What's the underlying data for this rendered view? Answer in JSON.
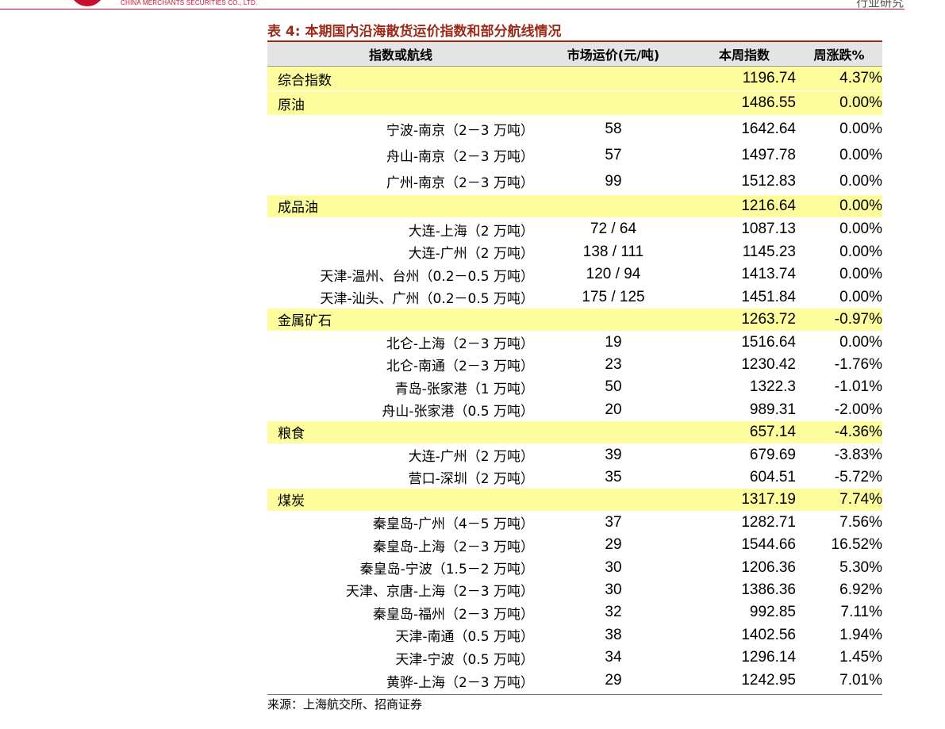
{
  "header": {
    "brand_text": "CHINA MERCHANTS SECURITIES CO., LTD.",
    "corner_text": "行业研究"
  },
  "table": {
    "caption": "表 4:  本期国内沿海散货运价指数和部分航线情况",
    "columns": [
      "指数或航线",
      "市场运价(元/吨)",
      "本周指数",
      "周涨跌%"
    ],
    "rows": [
      {
        "name": "综合指数",
        "price": "",
        "index": "1196.74",
        "change": "4.37%",
        "category": true
      },
      {
        "name": "原油",
        "price": "",
        "index": "1486.55",
        "change": "0.00%",
        "category": true
      },
      {
        "name": "宁波-南京（2－3 万吨）",
        "price": "58",
        "index": "1642.64",
        "change": "0.00%",
        "category": false
      },
      {
        "name": "舟山-南京（2－3 万吨）",
        "price": "57",
        "index": "1497.78",
        "change": "0.00%",
        "category": false
      },
      {
        "name": "广州-南京（2－3 万吨）",
        "price": "99",
        "index": "1512.83",
        "change": "0.00%",
        "category": false
      },
      {
        "name": "成品油",
        "price": "",
        "index": "1216.64",
        "change": "0.00%",
        "category": true
      },
      {
        "name": "大连-上海（2 万吨）",
        "price": "72 / 64",
        "index": "1087.13",
        "change": "0.00%",
        "category": false
      },
      {
        "name": "大连-广州（2 万吨）",
        "price": "138 / 111",
        "index": "1145.23",
        "change": "0.00%",
        "category": false
      },
      {
        "name": "天津-温州、台州（0.2－0.5 万吨）",
        "price": "120 / 94",
        "index": "1413.74",
        "change": "0.00%",
        "category": false
      },
      {
        "name": "天津-汕头、广州（0.2－0.5 万吨）",
        "price": "175 / 125",
        "index": "1451.84",
        "change": "0.00%",
        "category": false
      },
      {
        "name": "金属矿石",
        "price": "",
        "index": "1263.72",
        "change": "-0.97%",
        "category": true
      },
      {
        "name": "北仑-上海（2－3 万吨）",
        "price": "19",
        "index": "1516.64",
        "change": "0.00%",
        "category": false
      },
      {
        "name": "北仑-南通（2－3 万吨）",
        "price": "23",
        "index": "1230.42",
        "change": "-1.76%",
        "category": false
      },
      {
        "name": "青岛-张家港（1 万吨）",
        "price": "50",
        "index": "1322.3",
        "change": "-1.01%",
        "category": false
      },
      {
        "name": "舟山-张家港（0.5 万吨）",
        "price": "20",
        "index": "989.31",
        "change": "-2.00%",
        "category": false
      },
      {
        "name": "粮食",
        "price": "",
        "index": "657.14",
        "change": "-4.36%",
        "category": true
      },
      {
        "name": "大连-广州（2 万吨）",
        "price": "39",
        "index": "679.69",
        "change": "-3.83%",
        "category": false
      },
      {
        "name": "营口-深圳（2 万吨）",
        "price": "35",
        "index": "604.51",
        "change": "-5.72%",
        "category": false
      },
      {
        "name": "煤炭",
        "price": "",
        "index": "1317.19",
        "change": "7.74%",
        "category": true
      },
      {
        "name": "秦皇岛-广州（4－5 万吨）",
        "price": "37",
        "index": "1282.71",
        "change": "7.56%",
        "category": false
      },
      {
        "name": "秦皇岛-上海（2－3 万吨）",
        "price": "29",
        "index": "1544.66",
        "change": "16.52%",
        "category": false
      },
      {
        "name": "秦皇岛-宁波（1.5－2 万吨）",
        "price": "30",
        "index": "1206.36",
        "change": "5.30%",
        "category": false
      },
      {
        "name": "天津、京唐-上海（2－3 万吨）",
        "price": "30",
        "index": "1386.36",
        "change": "6.92%",
        "category": false
      },
      {
        "name": "秦皇岛-福州（2－3 万吨）",
        "price": "32",
        "index": "992.85",
        "change": "7.11%",
        "category": false
      },
      {
        "name": "天津-南通（0.5 万吨）",
        "price": "38",
        "index": "1402.56",
        "change": "1.94%",
        "category": false
      },
      {
        "name": "天津-宁波（0.5 万吨）",
        "price": "34",
        "index": "1296.14",
        "change": "1.45%",
        "category": false
      },
      {
        "name": "黄骅-上海（2－3 万吨）",
        "price": "29",
        "index": "1242.95",
        "change": "7.01%",
        "category": false
      }
    ]
  },
  "source": "来源：上海航交所、招商证券"
}
